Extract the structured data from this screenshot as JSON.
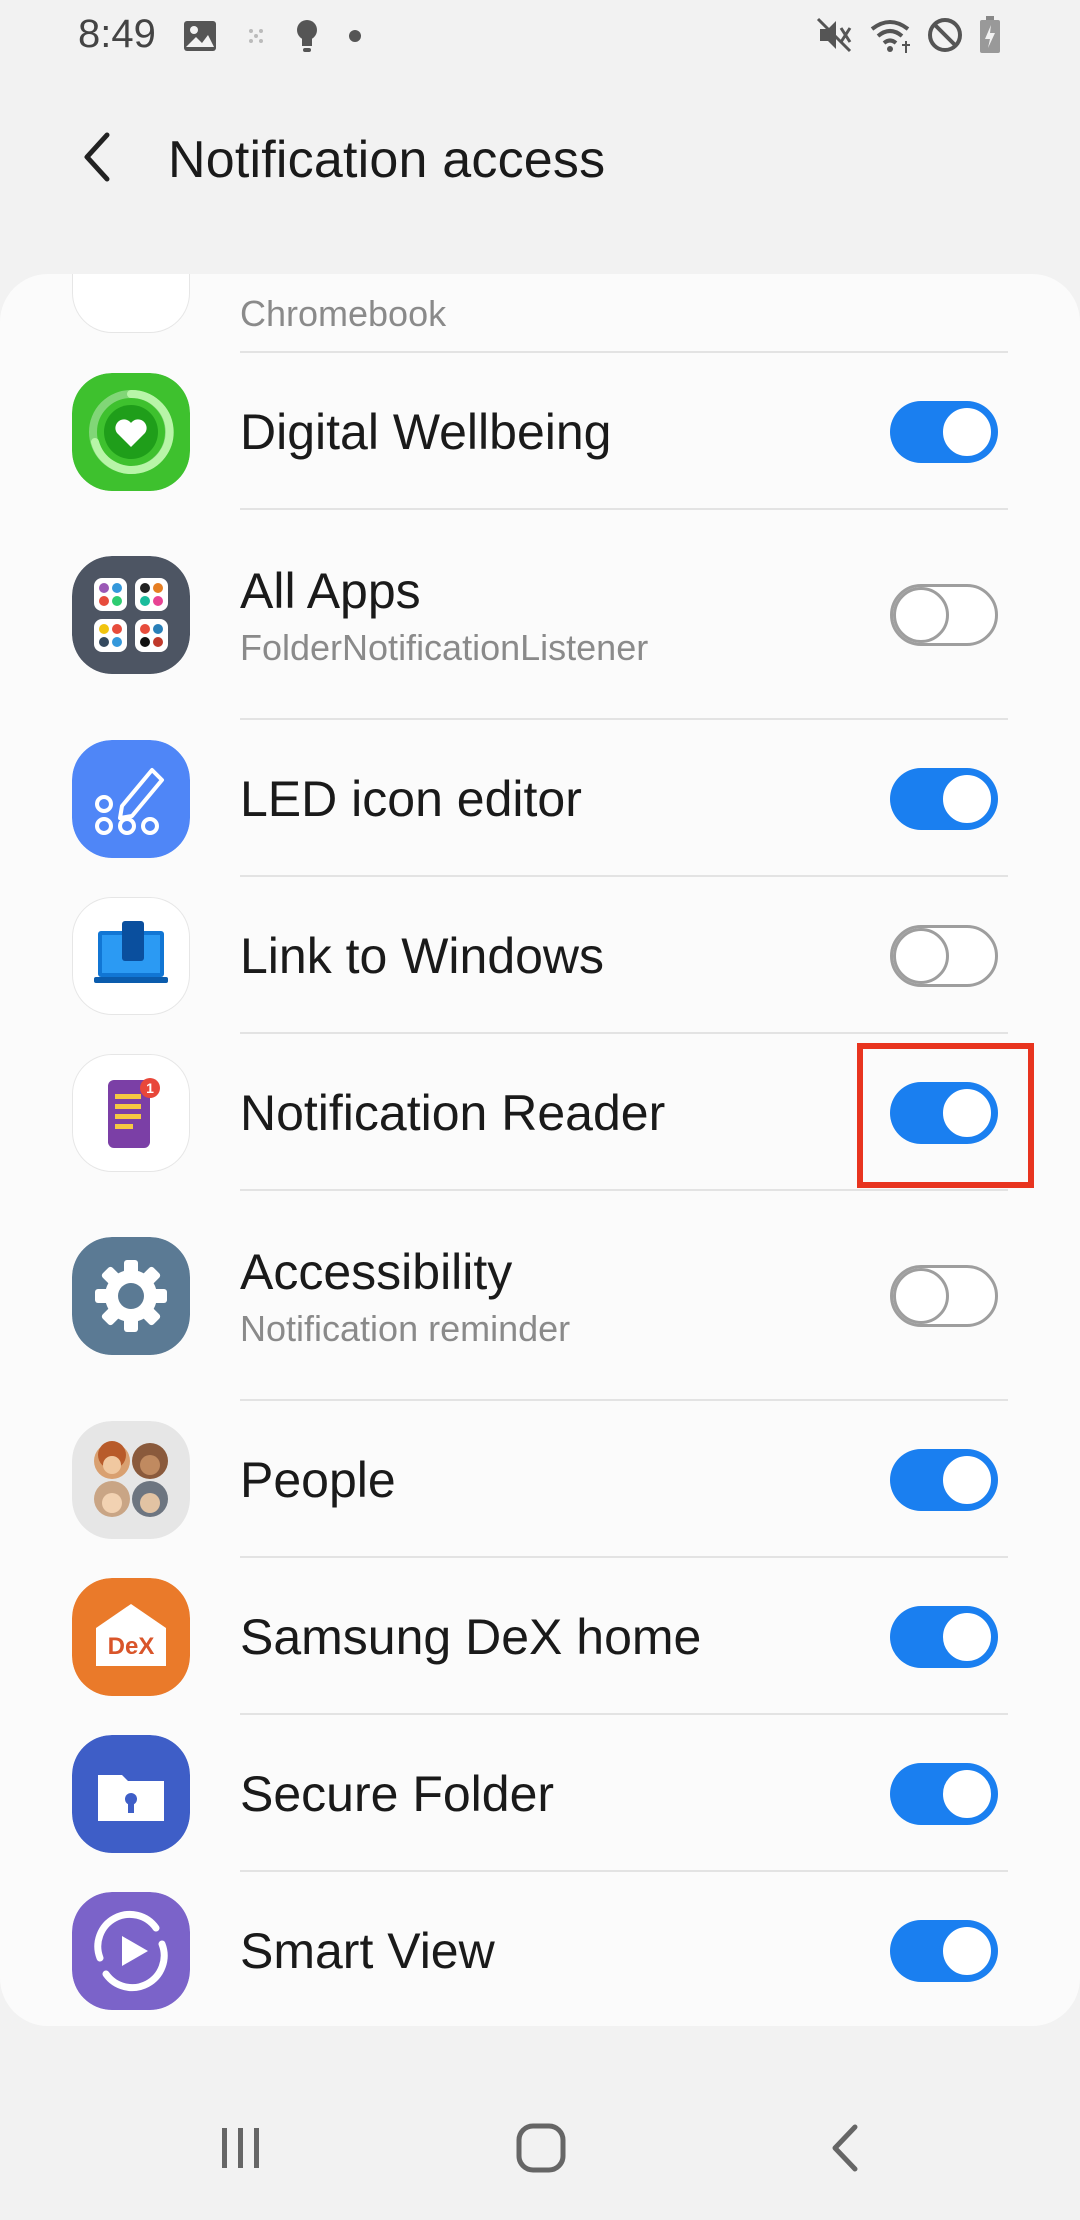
{
  "status_bar": {
    "time": "8:49",
    "left_icons": [
      "image-icon",
      "dots-icon",
      "bulb-icon",
      "dot-icon"
    ],
    "right_icons": [
      "mute-icon",
      "wifi-icon",
      "dnd-icon",
      "battery-icon"
    ]
  },
  "header": {
    "title": "Notification access"
  },
  "apps": [
    {
      "name": "",
      "subtitle": "Chromebook",
      "enabled": null,
      "icon": "chromebook-app-icon"
    },
    {
      "name": "Digital Wellbeing",
      "subtitle": "",
      "enabled": true,
      "icon": "digital-wellbeing-icon"
    },
    {
      "name": "All Apps",
      "subtitle": "FolderNotificationListener",
      "enabled": false,
      "icon": "all-apps-folder-icon"
    },
    {
      "name": "LED icon editor",
      "subtitle": "",
      "enabled": true,
      "icon": "led-icon-editor-icon"
    },
    {
      "name": "Link to Windows",
      "subtitle": "",
      "enabled": false,
      "icon": "link-to-windows-icon"
    },
    {
      "name": "Notification Reader",
      "subtitle": "",
      "enabled": true,
      "icon": "notification-reader-icon"
    },
    {
      "name": "Accessibility",
      "subtitle": "Notification reminder",
      "enabled": false,
      "icon": "accessibility-gear-icon"
    },
    {
      "name": "People",
      "subtitle": "",
      "enabled": true,
      "icon": "people-icon"
    },
    {
      "name": "Samsung DeX home",
      "subtitle": "",
      "enabled": true,
      "icon": "samsung-dex-icon"
    },
    {
      "name": "Secure Folder",
      "subtitle": "",
      "enabled": true,
      "icon": "secure-folder-icon"
    },
    {
      "name": "Smart View",
      "subtitle": "",
      "enabled": true,
      "icon": "smart-view-icon"
    }
  ],
  "icon_labels": {
    "dex": "DeX"
  },
  "highlight": {
    "target": "Notification Reader toggle",
    "color": "#e8341f"
  },
  "colors": {
    "accent": "#1a7ff0",
    "highlight": "#e8341f"
  },
  "nav_bar": [
    "recents-icon",
    "home-icon",
    "back-icon"
  ]
}
